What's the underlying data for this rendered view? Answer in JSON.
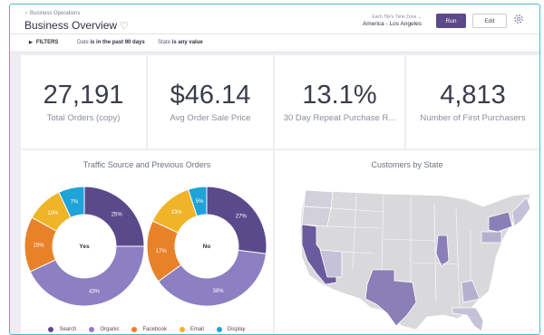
{
  "header": {
    "breadcrumb": "Business Operations",
    "title": "Business Overview",
    "timezone_label": "Each Tile's Time Zone",
    "timezone_value": "America - Los Angeles",
    "run_label": "Run",
    "edit_label": "Edit"
  },
  "filters": {
    "toggle_label": "FILTERS",
    "date_prefix": "Date",
    "date_value": "is in the past 90 days",
    "state_prefix": "State",
    "state_value": "is any value"
  },
  "kpis": [
    {
      "value": "27,191",
      "label": "Total Orders (copy)"
    },
    {
      "value": "$46.14",
      "label": "Avg Order Sale Price"
    },
    {
      "value": "13.1%",
      "label": "30 Day Repeat Purchase R..."
    },
    {
      "value": "4,813",
      "label": "Number of First Purchasers"
    }
  ],
  "traffic": {
    "title": "Traffic Source and Previous Orders",
    "legend": [
      {
        "name": "Search",
        "color": "#5b4a8b"
      },
      {
        "name": "Organic",
        "color": "#8c7fc2"
      },
      {
        "name": "Facebook",
        "color": "#e8822a"
      },
      {
        "name": "Email",
        "color": "#f0b429"
      },
      {
        "name": "Display",
        "color": "#1fa3d9"
      }
    ],
    "donuts": [
      {
        "center": "Yes",
        "values": [
          25,
          43,
          15,
          10,
          7
        ],
        "labels": [
          "25%",
          "43%",
          "15%",
          "10%",
          "7%"
        ]
      },
      {
        "center": "No",
        "values": [
          27,
          38,
          17,
          13,
          5
        ],
        "labels": [
          "27%",
          "38%",
          "17%",
          "13%",
          "5%"
        ]
      }
    ]
  },
  "map": {
    "title": "Customers by State",
    "colors": {
      "low": "#d9d9dc",
      "mid": "#b6b0cf",
      "high": "#8a7fb7",
      "top": "#6a5a9e"
    }
  },
  "chart_data": {
    "type": "pie",
    "title": "Traffic Source and Previous Orders",
    "categories": [
      "Search",
      "Organic",
      "Facebook",
      "Email",
      "Display"
    ],
    "series": [
      {
        "name": "Yes",
        "values": [
          25,
          43,
          15,
          10,
          7
        ]
      },
      {
        "name": "No",
        "values": [
          27,
          38,
          17,
          13,
          5
        ]
      }
    ],
    "legend": "bottom"
  }
}
